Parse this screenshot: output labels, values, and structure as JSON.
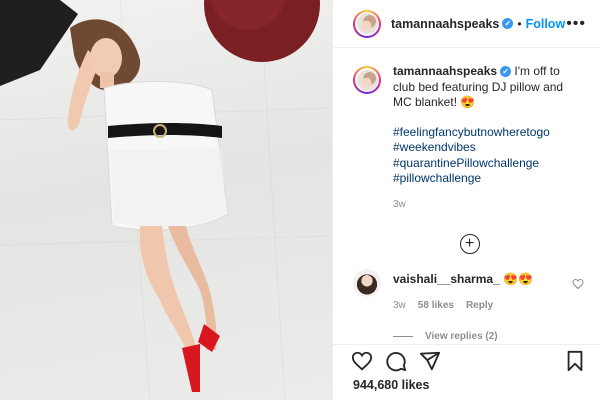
{
  "post": {
    "username": "tamannaahspeaks",
    "verified_mark": "✓",
    "dot": "•",
    "follow_label": "Follow",
    "more_label": "•••",
    "caption_text": " I'm off to club bed featuring DJ pillow and MC blanket! 😍",
    "hashtags": [
      "#feelingfancybutnowheretogo",
      "#weekendvibes",
      "#quarantinePillowchallenge",
      "#pillowchallenge"
    ],
    "caption_age": "3w",
    "load_more_label": "+",
    "likes_count": "944,680 likes"
  },
  "comment": {
    "username": "vaishali__sharma_",
    "text": " 😍😍",
    "age": "3w",
    "likes": "58 likes",
    "reply_label": "Reply",
    "view_replies": "View replies (2)"
  },
  "icons": {
    "like": "heart-icon",
    "comment": "comment-icon",
    "share": "share-icon",
    "save": "bookmark-icon",
    "comment_like": "heart-small-icon"
  },
  "colors": {
    "follow": "#0095f6",
    "hashtag": "#00376b",
    "verified": "#3897f0",
    "muted": "#8e8e8e"
  }
}
